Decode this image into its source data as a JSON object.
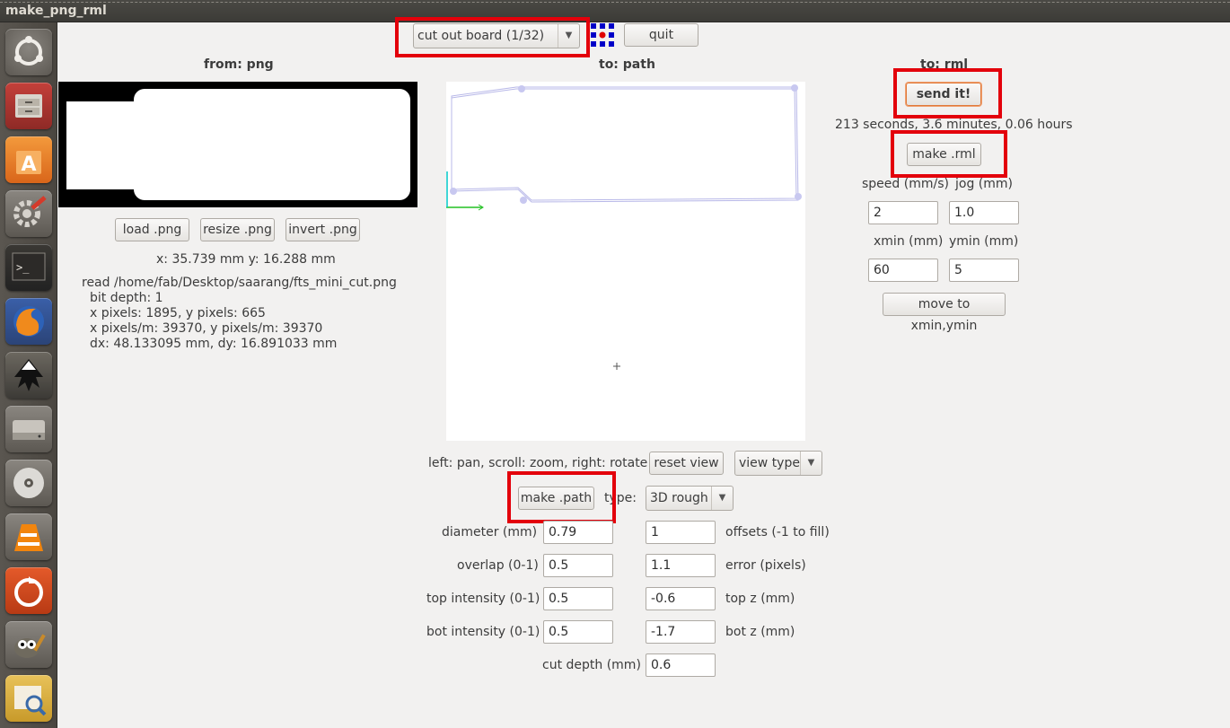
{
  "window": {
    "title": "make_png_rml"
  },
  "launcher": {
    "items": [
      {
        "name": "ubuntu-dash"
      },
      {
        "name": "files"
      },
      {
        "name": "software-center"
      },
      {
        "name": "system-settings"
      },
      {
        "name": "terminal"
      },
      {
        "name": "firefox"
      },
      {
        "name": "inkscape"
      },
      {
        "name": "disk-drive"
      },
      {
        "name": "optical-disc"
      },
      {
        "name": "vlc"
      },
      {
        "name": "update-manager"
      },
      {
        "name": "gimp"
      },
      {
        "name": "image-viewer"
      }
    ]
  },
  "toolbar": {
    "process_selected": "cut out board (1/32)",
    "quit_label": "quit"
  },
  "png_panel": {
    "header": "from: png",
    "load_label": "load .png",
    "resize_label": "resize .png",
    "invert_label": "invert .png",
    "coords": "x: 35.739 mm  y: 16.288 mm",
    "info": {
      "read": "read /home/fab/Desktop/saarang/fts_mini_cut.png",
      "bit_depth": "bit depth: 1",
      "pixels": "x pixels: 1895, y pixels: 665",
      "pixels_per_m": "x pixels/m: 39370, y pixels/m: 39370",
      "size": "dx: 48.133095 mm, dy: 16.891033 mm"
    }
  },
  "path_panel": {
    "header": "to: path",
    "hint": "left: pan, scroll: zoom, right: rotate",
    "reset_view_label": "reset view",
    "view_type_label": "view type",
    "make_path_label": "make .path",
    "type_label": "type:",
    "type_selected": "3D rough",
    "fields": {
      "diameter_label": "diameter (mm)",
      "diameter": "0.79",
      "offsets_label": "offsets (-1 to fill)",
      "offsets": "1",
      "overlap_label": "overlap (0-1)",
      "overlap": "0.5",
      "error_label": "error (pixels)",
      "error": "1.1",
      "top_intensity_label": "top intensity (0-1)",
      "top_intensity": "0.5",
      "top_z_label": "top z (mm)",
      "top_z": "-0.6",
      "bot_intensity_label": "bot intensity (0-1)",
      "bot_intensity": "0.5",
      "bot_z_label": "bot z (mm)",
      "bot_z": "-1.7",
      "cut_depth_label": "cut depth (mm)",
      "cut_depth": "0.6"
    }
  },
  "rml_panel": {
    "header": "to: rml",
    "send_label": "send it!",
    "time_estimate": "213 seconds, 3.6 minutes, 0.06 hours",
    "make_rml_label": "make .rml",
    "speed_label": "speed (mm/s)",
    "speed": "2",
    "jog_label": "jog (mm)",
    "jog": "1.0",
    "xmin_label": "xmin (mm)",
    "xmin": "60",
    "ymin_label": "ymin (mm)",
    "ymin": "5",
    "move_label": "move to xmin,ymin"
  },
  "colors": {
    "highlight": "#e3000b",
    "path_line": "#b8b8e8",
    "axis_x": "#22c022",
    "axis_y": "#00c8c8"
  }
}
